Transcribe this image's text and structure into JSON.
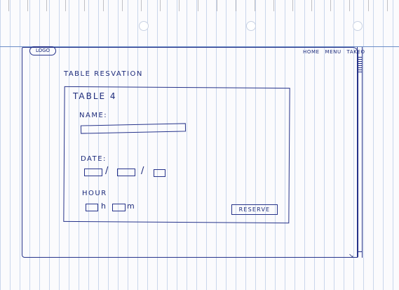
{
  "header": {
    "logo": "LOGO",
    "nav": [
      {
        "label": "HOME"
      },
      {
        "label": "MENU"
      },
      {
        "label": "TAKEO"
      }
    ]
  },
  "main": {
    "page_title": "TABLE RESVATION",
    "panel": {
      "title": "TABLE 4",
      "name_label": "NAME:",
      "name_value": "",
      "date_label": "DATE:",
      "date_day": "",
      "date_month": "",
      "date_year": "",
      "date_separator": "/",
      "hour_label": "HOUR",
      "hour_value": "",
      "minute_value": "",
      "hour_unit": "h",
      "minute_unit": "m",
      "reserve_label": "RESERVE"
    }
  },
  "colors": {
    "ink": "#1c2a7a",
    "paper": "#fbfbfd",
    "rule_lines": "#8caad7"
  }
}
